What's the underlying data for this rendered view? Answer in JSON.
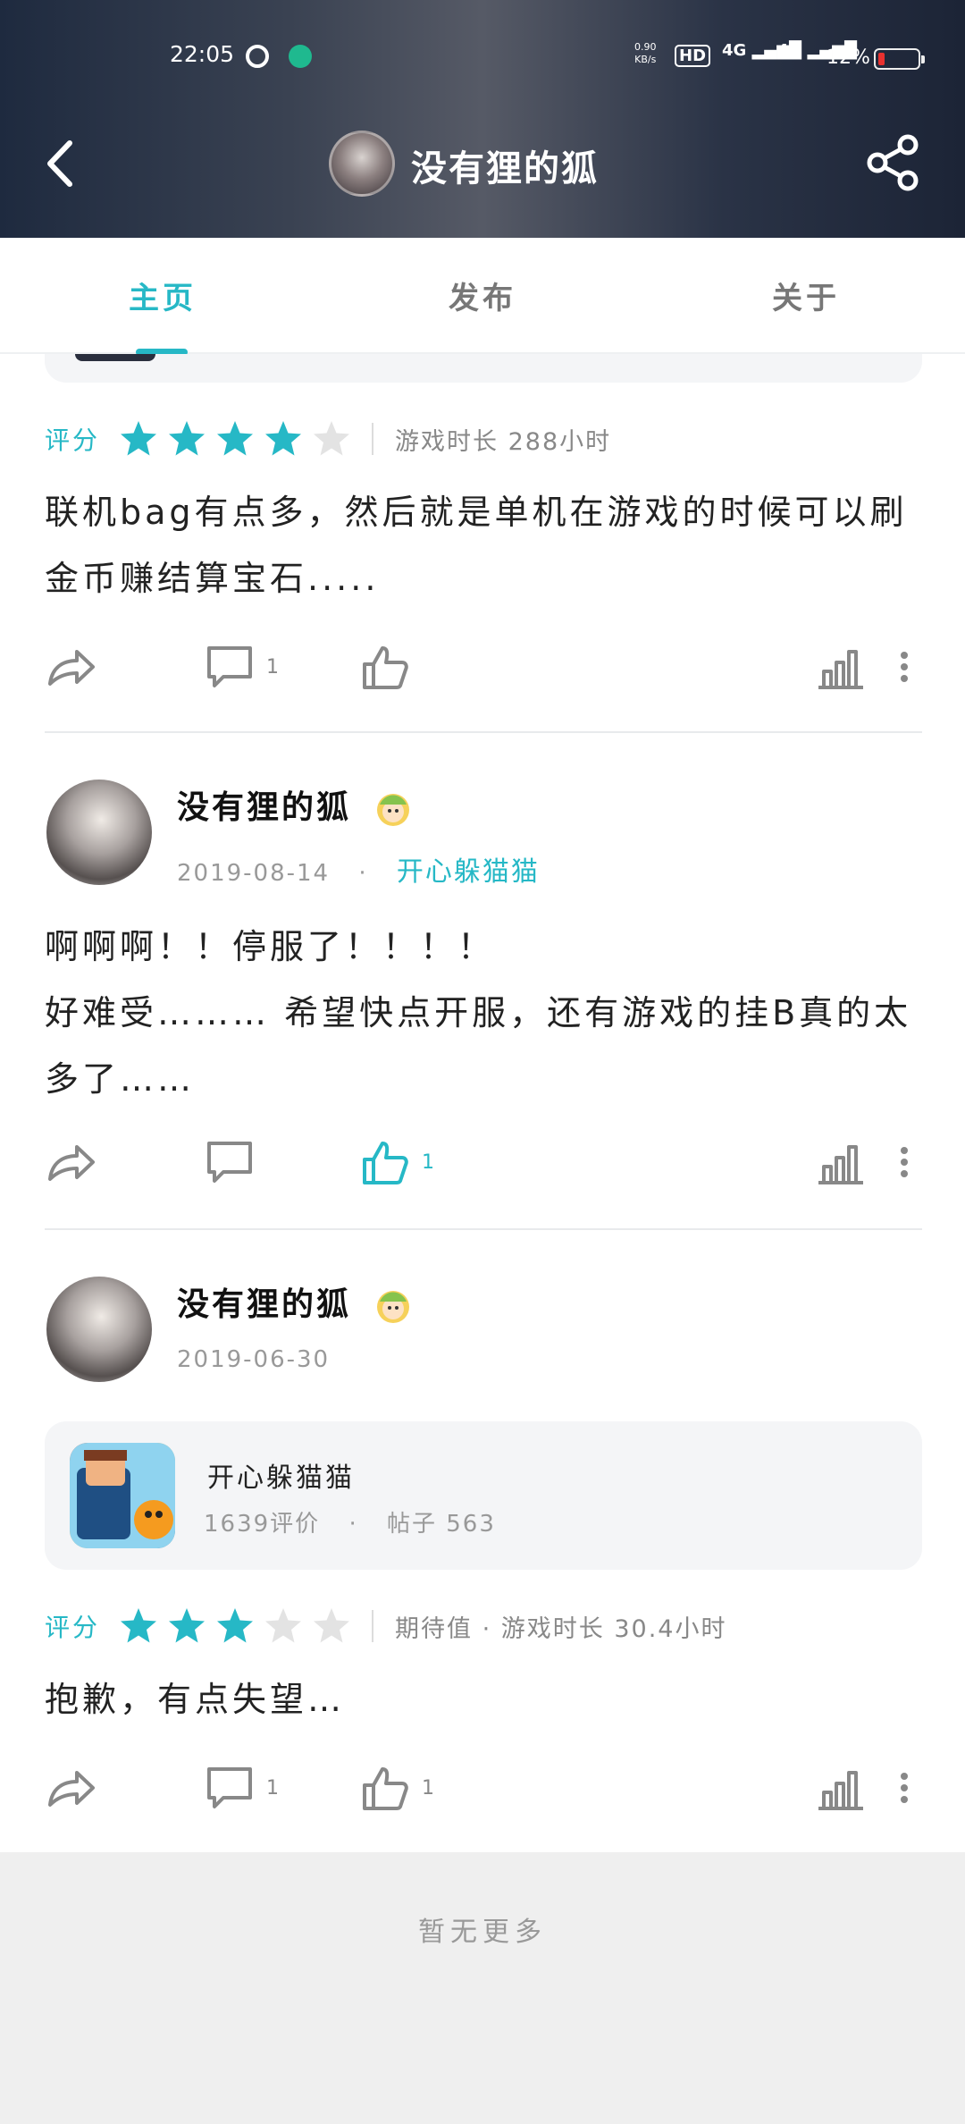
{
  "status_bar": {
    "time": "22:05",
    "net_speed": "0.90",
    "net_unit": "KB/s",
    "hd": "HD",
    "sig1": "4G",
    "sig2": "4G",
    "battery_text": "12%"
  },
  "header": {
    "title": "没有狸的狐"
  },
  "tabs": [
    "主页",
    "发布",
    "关于"
  ],
  "posts": [
    {
      "rating_label": "评分",
      "stars": 4,
      "meta": "游戏时长  288小时",
      "text": "联机bag有点多，然后就是单机在游戏的时候可以刷金币赚结算宝石.....",
      "comment_count": "1",
      "like_count": ""
    },
    {
      "username": "没有狸的狐",
      "date": "2019-08-14",
      "dot": "·",
      "game": "开心躲猫猫",
      "text_line1": "啊啊啊！！停服了！！！！",
      "text_line2": "好难受……… 希望快点开服，还有游戏的挂B真的太多了……",
      "comment_count": "",
      "like_count": "1"
    },
    {
      "username": "没有狸的狐",
      "date": "2019-06-30",
      "game_card": {
        "title": "开心躲猫猫",
        "reviews": "1639评价",
        "dot": "·",
        "posts": "帖子 563"
      },
      "rating_label": "评分",
      "stars": 3,
      "meta": "期待值  ·  游戏时长  30.4小时",
      "text": "抱歉，有点失望…",
      "comment_count": "1",
      "like_count": "1"
    }
  ],
  "footer": {
    "end_text": "暂无更多"
  },
  "colors": {
    "accent": "#26b8c6",
    "star_on": "#26b8c6",
    "star_off": "#e3e3e3"
  }
}
